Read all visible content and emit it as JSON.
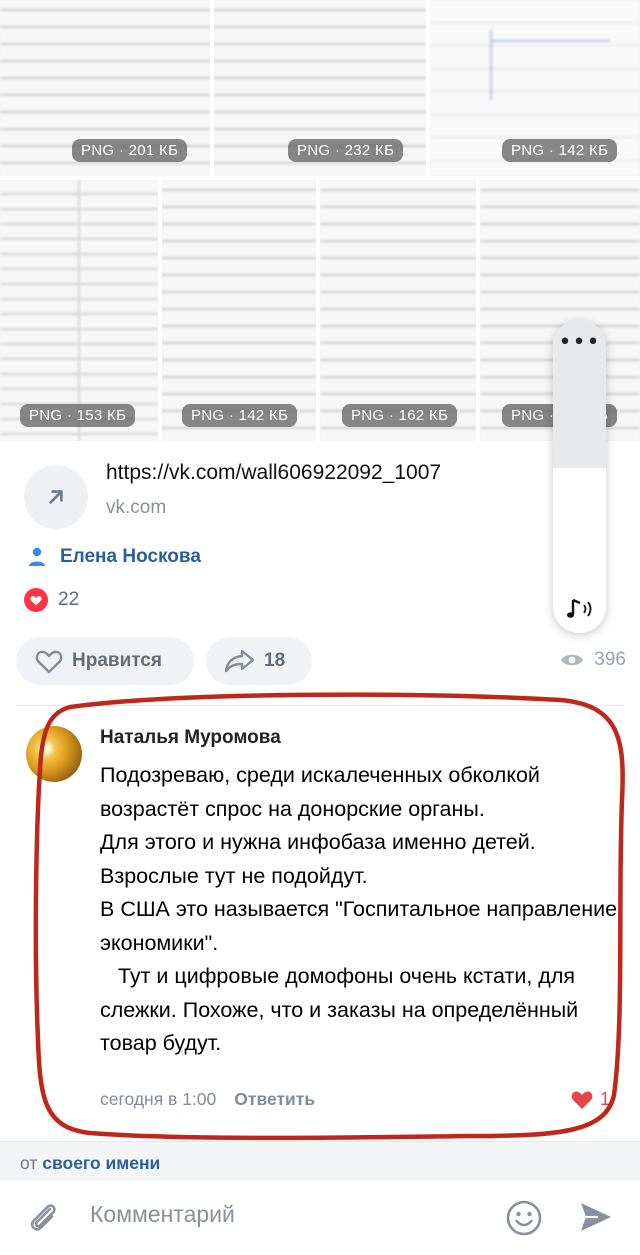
{
  "attachments": [
    {
      "badge": "PNG · 201 КБ"
    },
    {
      "badge": "PNG · 232 КБ"
    },
    {
      "badge": "PNG · 142 КБ"
    },
    {
      "badge": "PNG · 153 КБ"
    },
    {
      "badge": "PNG · 142 КБ"
    },
    {
      "badge": "PNG · 162 КБ"
    },
    {
      "badge": "PNG · 142 КБ"
    }
  ],
  "link": {
    "url": "https://vk.com/wall606922092_1007",
    "domain": "vk.com"
  },
  "post": {
    "author": "Елена Носкова",
    "likes": "22",
    "like_button": "Нравится",
    "shares": "18",
    "views": "396"
  },
  "player": {
    "menu": "•••"
  },
  "comment": {
    "author": "Наталья Муромова",
    "text": "Подозреваю, среди искалеченных обколкой возрастёт спрос на донорские органы.\nДля этого и нужна инфобаза именно детей. Взрослые тут не подойдут.\nВ США это называется \"Госпитальное направление экономики\".\n   Тут и цифровые домофоны очень кстати, для слежки. Похоже, что и заказы на определённый товар будут.",
    "time": "сегодня в 1:00",
    "reply": "Ответить",
    "likes": "1"
  },
  "composer": {
    "from_prefix": "от",
    "from_link": "своего имени",
    "placeholder": "Комментарий"
  },
  "colors": {
    "accent": "#2a5f9e",
    "like_red": "#e64646",
    "annotation_red": "#c0271b"
  }
}
